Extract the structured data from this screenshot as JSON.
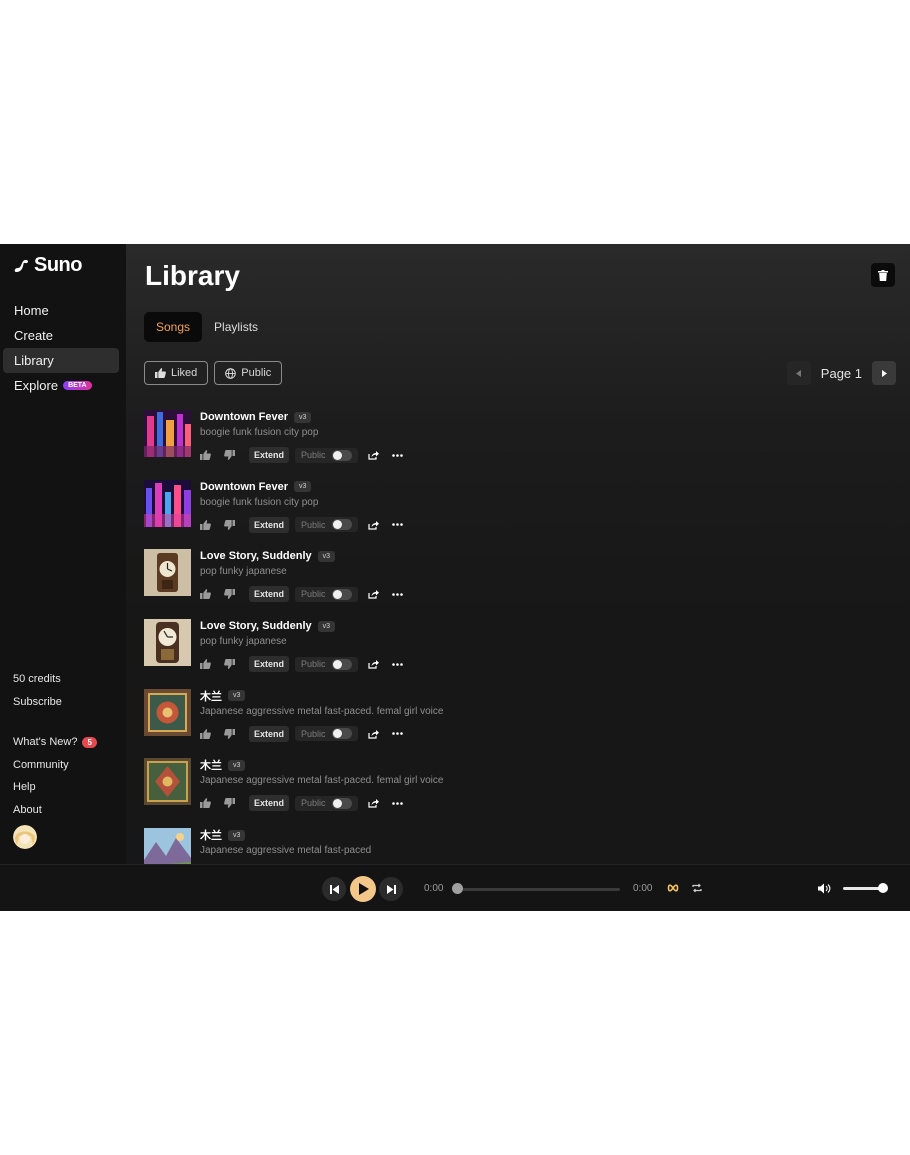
{
  "sidebar": {
    "logo_text": "Suno",
    "nav": [
      {
        "label": "Home",
        "active": false
      },
      {
        "label": "Create",
        "active": false
      },
      {
        "label": "Library",
        "active": true
      },
      {
        "label": "Explore",
        "active": false,
        "badge": "BETA"
      }
    ],
    "credits": "50 credits",
    "subscribe": "Subscribe",
    "whats_new": "What's New?",
    "whats_new_count": "5",
    "community": "Community",
    "help": "Help",
    "about": "About"
  },
  "main": {
    "title": "Library",
    "tabs": [
      {
        "label": "Songs",
        "active": true
      },
      {
        "label": "Playlists",
        "active": false
      }
    ],
    "filters": [
      {
        "label": "Liked",
        "icon": "thumbs-up-icon"
      },
      {
        "label": "Public",
        "icon": "globe-icon"
      }
    ],
    "pager_label": "Page 1"
  },
  "songs": [
    {
      "title": "Downtown Fever",
      "version": "v3",
      "description": "boogie funk fusion city pop",
      "art": "city"
    },
    {
      "title": "Downtown Fever",
      "version": "v3",
      "description": "boogie funk fusion city pop",
      "art": "city2"
    },
    {
      "title": "Love Story, Suddenly",
      "version": "v3",
      "description": "pop funky japanese",
      "art": "clock"
    },
    {
      "title": "Love Story, Suddenly",
      "version": "v3",
      "description": "pop funky japanese",
      "art": "clock2"
    },
    {
      "title": "木兰",
      "version": "v3",
      "description": "Japanese aggressive metal fast-paced. femal girl voice",
      "art": "ornate"
    },
    {
      "title": "木兰",
      "version": "v3",
      "description": "Japanese aggressive metal fast-paced. femal girl voice",
      "art": "ornate2"
    },
    {
      "title": "木兰",
      "version": "v3",
      "description": "Japanese aggressive metal fast-paced",
      "art": "landscape"
    }
  ],
  "song_actions": {
    "extend": "Extend",
    "public": "Public"
  },
  "player": {
    "time_current": "0:00",
    "time_total": "0:00",
    "progress": 0,
    "volume": 0.85
  },
  "colors": {
    "accent_orange": "#f5a255",
    "play_button": "#f3c78a",
    "beta_gradient_start": "#8b3ff7",
    "beta_gradient_end": "#e0309b",
    "badge_red": "#e5484d"
  }
}
